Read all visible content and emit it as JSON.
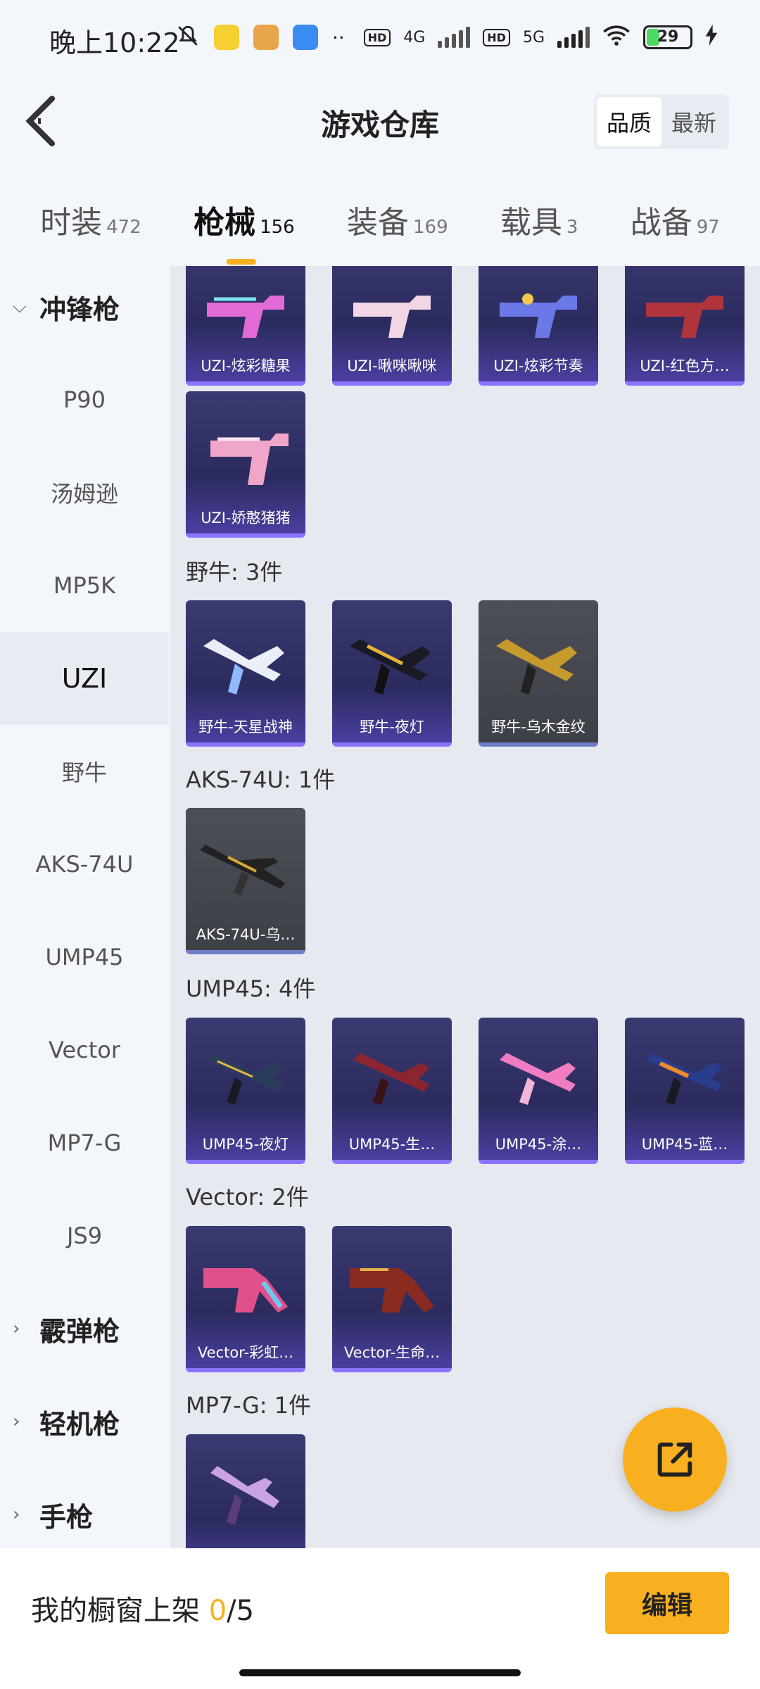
{
  "status": {
    "time": "晚上10:22",
    "net1": "4G",
    "net2": "5G",
    "battery": "29"
  },
  "header": {
    "title": "游戏仓库",
    "sort_quality": "品质",
    "sort_latest": "最新"
  },
  "tabs": [
    {
      "label": "时装",
      "count": "472"
    },
    {
      "label": "枪械",
      "count": "156"
    },
    {
      "label": "装备",
      "count": "169"
    },
    {
      "label": "载具",
      "count": "3"
    },
    {
      "label": "战备",
      "count": "97"
    }
  ],
  "sidebar": {
    "group1": "冲锋枪",
    "items": [
      "P90",
      "汤姆逊",
      "MP5K",
      "UZI",
      "野牛",
      "AKS-74U",
      "UMP45",
      "Vector",
      "MP7-G",
      "JS9"
    ],
    "group2": "霰弹枪",
    "group3": "轻机枪",
    "group4": "手枪"
  },
  "content": {
    "uzi_row1": [
      "UZI-炫彩糖果",
      "UZI-啾咪啾咪",
      "UZI-炫彩节奏",
      "UZI-红色方…"
    ],
    "uzi_row2": [
      "UZI-娇憨猪猪"
    ],
    "bison_header": "野牛: 3件",
    "bison": [
      "野牛-天星战神",
      "野牛-夜灯",
      "野牛-乌木金纹"
    ],
    "aks_header": "AKS-74U: 1件",
    "aks": [
      "AKS-74U-乌…"
    ],
    "ump_header": "UMP45: 4件",
    "ump": [
      "UMP45-夜灯",
      "UMP45-生…",
      "UMP45-涂…",
      "UMP45-蓝…"
    ],
    "vector_header": "Vector: 2件",
    "vector": [
      "Vector-彩虹…",
      "Vector-生命…"
    ],
    "mp7_header": "MP7-G: 1件"
  },
  "bottom": {
    "shelf_label": "我的橱窗上架",
    "shelf_count": "0",
    "shelf_total": "/5",
    "edit": "编辑"
  },
  "colors": {
    "accent": "#f8b020",
    "card_purple": "#2b2b5e",
    "card_gray": "#4d4f58"
  }
}
